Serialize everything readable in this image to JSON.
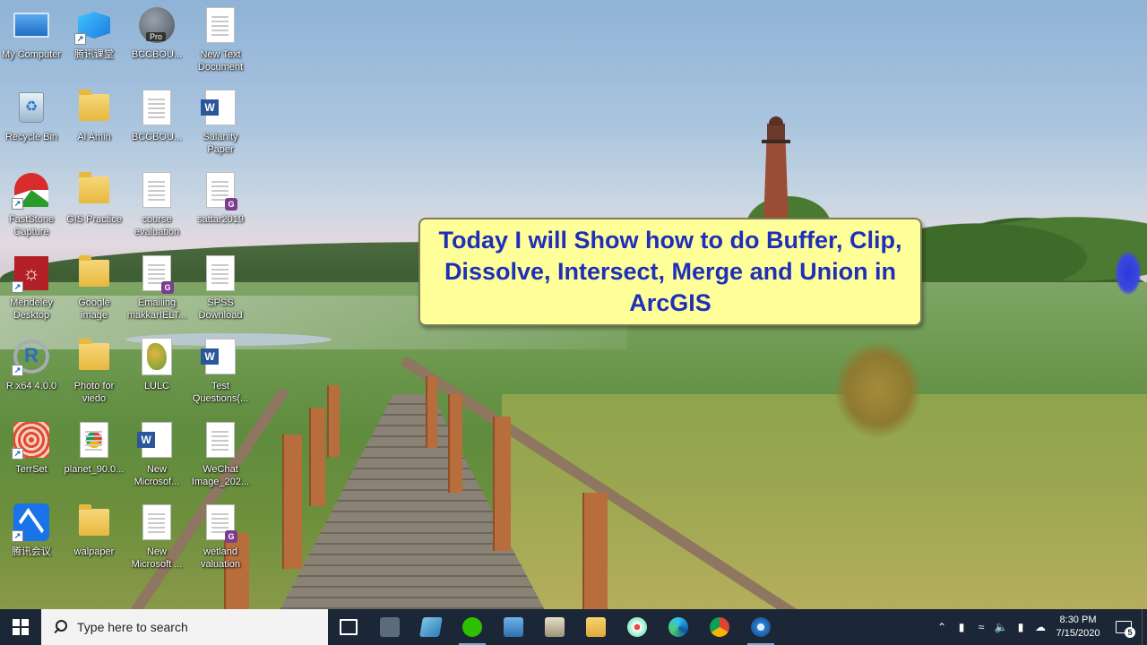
{
  "desktop": {
    "icons": [
      {
        "label": "My Computer",
        "icon": "computer-icon"
      },
      {
        "label": "腾讯课堂",
        "icon": "tencent-classroom-icon"
      },
      {
        "label": "BCCBOU...",
        "icon": "arcgis-pro-icon",
        "badge": "Pro"
      },
      {
        "label": "New Text Document",
        "icon": "text-document-icon"
      },
      {
        "label": "Recycle Bin",
        "icon": "recycle-bin-icon"
      },
      {
        "label": "Al Amin",
        "icon": "folder-icon"
      },
      {
        "label": "BCCBOU...",
        "icon": "blank-document-icon"
      },
      {
        "label": "Salanity Paper",
        "icon": "word-document-icon"
      },
      {
        "label": "FastStone Capture",
        "icon": "faststone-capture-icon"
      },
      {
        "label": "GIS Practice",
        "icon": "folder-icon"
      },
      {
        "label": "course evaluation",
        "icon": "text-document-icon"
      },
      {
        "label": "sattar2019",
        "icon": "gis-document-icon"
      },
      {
        "label": "Mendeley Desktop",
        "icon": "mendeley-icon"
      },
      {
        "label": "Google image",
        "icon": "folder-icon"
      },
      {
        "label": "Emailing makkarIELT...",
        "icon": "gis-document-icon"
      },
      {
        "label": "SPSS Download",
        "icon": "text-document-icon"
      },
      {
        "label": "R x64 4.0.0",
        "icon": "r-language-icon"
      },
      {
        "label": "Photo for viedo",
        "icon": "folder-icon"
      },
      {
        "label": "LULC",
        "icon": "map-image-icon"
      },
      {
        "label": "Test Questions(...",
        "icon": "word-document-icon"
      },
      {
        "label": "TerrSet",
        "icon": "terrset-icon"
      },
      {
        "label": "planet_90.0...",
        "icon": "chrome-file-icon"
      },
      {
        "label": "New Microsof...",
        "icon": "word-document-icon"
      },
      {
        "label": "WeChat Image_202...",
        "icon": "image-file-icon"
      },
      {
        "label": "腾讯会议",
        "icon": "tencent-meeting-icon"
      },
      {
        "label": "walpaper",
        "icon": "folder-icon"
      },
      {
        "label": "New Microsoft ...",
        "icon": "blank-document-icon"
      },
      {
        "label": "wetland valuation",
        "icon": "gis-document-icon"
      }
    ]
  },
  "callout": {
    "text": "Today I will Show how to do Buffer, Clip, Dissolve, Intersect, Merge and Union in ArcGIS",
    "text_color": "#1f2fb8",
    "background": "#ffff99"
  },
  "taskbar": {
    "search_placeholder": "Type here to search",
    "apps": [
      {
        "icon": "task-view-icon",
        "active": false
      },
      {
        "icon": "calculator-icon",
        "active": false
      },
      {
        "icon": "notes-icon",
        "active": false
      },
      {
        "icon": "wechat-icon",
        "active": true
      },
      {
        "icon": "remote-desktop-icon",
        "active": false
      },
      {
        "icon": "scanner-icon",
        "active": false
      },
      {
        "icon": "file-explorer-icon",
        "active": false
      },
      {
        "icon": "paint-icon",
        "active": false
      },
      {
        "icon": "edge-icon",
        "active": false
      },
      {
        "icon": "chrome-icon",
        "active": false
      },
      {
        "icon": "arcgis-icon",
        "active": true
      }
    ],
    "tray": {
      "time": "8:30 PM",
      "date": "7/15/2020",
      "notification_count": "5"
    }
  }
}
